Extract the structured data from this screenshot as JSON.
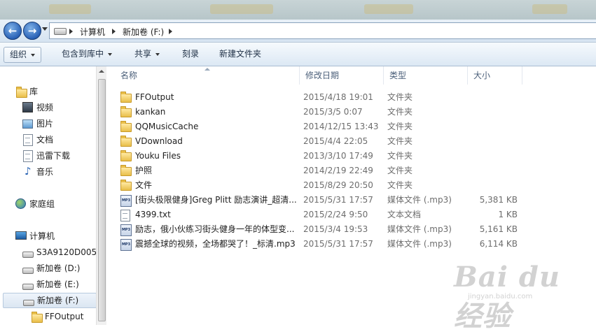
{
  "address": {
    "crumbs": [
      "计算机",
      "新加卷 (F:)"
    ]
  },
  "toolbar": {
    "items": [
      "组织",
      "包含到库中",
      "共享",
      "刻录",
      "新建文件夹"
    ]
  },
  "nav": {
    "library": "库",
    "library_items": [
      "视频",
      "图片",
      "文档",
      "迅雷下载",
      "音乐"
    ],
    "homegroup": "家庭组",
    "computer": "计算机",
    "drives": [
      "S3A9120D005",
      "新加卷 (D:)",
      "新加卷 (E:)",
      "新加卷 (F:)"
    ],
    "subfolder": "FFOutput"
  },
  "columns": [
    "名称",
    "修改日期",
    "类型",
    "大小"
  ],
  "files": [
    {
      "name": "FFOutput",
      "date": "2015/4/18 19:01",
      "type": "文件夹",
      "size": "",
      "icon": "folder-icon"
    },
    {
      "name": "kankan",
      "date": "2015/3/5 0:07",
      "type": "文件夹",
      "size": "",
      "icon": "folder-icon"
    },
    {
      "name": "QQMusicCache",
      "date": "2014/12/15 13:43",
      "type": "文件夹",
      "size": "",
      "icon": "folder-icon"
    },
    {
      "name": "VDownload",
      "date": "2015/4/4 22:05",
      "type": "文件夹",
      "size": "",
      "icon": "folder-icon"
    },
    {
      "name": "Youku Files",
      "date": "2013/3/10 17:49",
      "type": "文件夹",
      "size": "",
      "icon": "folder-icon"
    },
    {
      "name": "护照",
      "date": "2014/2/19 22:49",
      "type": "文件夹",
      "size": "",
      "icon": "folder-icon"
    },
    {
      "name": "文件",
      "date": "2015/8/29 20:50",
      "type": "文件夹",
      "size": "",
      "icon": "folder-icon"
    },
    {
      "name": "[街头极限健身]Greg Plitt 励志演讲_超清...",
      "date": "2015/5/31 17:57",
      "type": "媒体文件 (.mp3)",
      "size": "5,381 KB",
      "icon": "mp3-file-icon"
    },
    {
      "name": "4399.txt",
      "date": "2015/2/24 9:50",
      "type": "文本文档",
      "size": "1 KB",
      "icon": "text-file-icon"
    },
    {
      "name": "励志，俄小伙练习街头健身一年的体型变...",
      "date": "2015/3/4 19:53",
      "type": "媒体文件 (.mp3)",
      "size": "5,161 KB",
      "icon": "mp3-file-icon"
    },
    {
      "name": "震撼全球的视频，全场都哭了！_标清.mp3",
      "date": "2015/5/31 17:57",
      "type": "媒体文件 (.mp3)",
      "size": "6,114 KB",
      "icon": "mp3-file-icon"
    }
  ],
  "watermark": {
    "logo": "Bai du 经验",
    "url": "jingyan.baidu.com"
  }
}
